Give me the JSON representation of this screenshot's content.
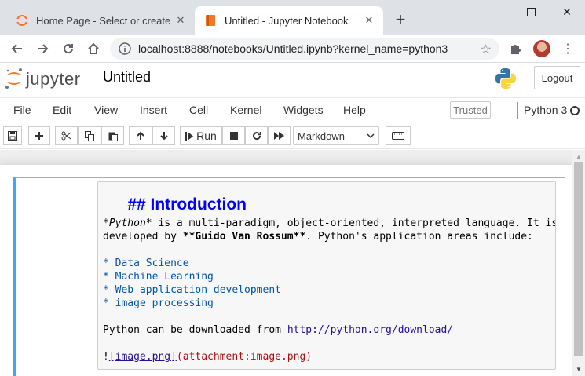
{
  "browser": {
    "tabs": [
      {
        "title": "Home Page - Select or create a n",
        "active": false
      },
      {
        "title": "Untitled - Jupyter Notebook",
        "active": true
      }
    ],
    "url": "localhost:8888/notebooks/Untitled.ipynb?kernel_name=python3"
  },
  "jupyter": {
    "logo_text": "jupyter",
    "notebook_name": "Untitled",
    "logout_label": "Logout",
    "menu": [
      "File",
      "Edit",
      "View",
      "Insert",
      "Cell",
      "Kernel",
      "Widgets",
      "Help"
    ],
    "trusted_label": "Trusted",
    "kernel_name": "Python 3",
    "toolbar": {
      "run_label": "Run",
      "cell_type": "Markdown"
    }
  },
  "cell": {
    "lines": {
      "heading": "## Introduction",
      "p1_em": "*Python*",
      "p1_rest": " is a multi-paradigm, object-oriented, interpreted language. It is",
      "p2_a": "developed by ",
      "p2_strong": "**Guido Van Rossum**",
      "p2_b": ". Python's application areas include:",
      "items": [
        "* Data Science",
        "* Machine Learning",
        "* Web application development",
        "* image processing"
      ],
      "download_prefix": "Python can be downloaded from ",
      "download_url": "http://python.org/download/",
      "img_bang": "!",
      "img_alt": "[image.png]",
      "img_target": "(attachment:image.png)"
    }
  },
  "colors": {
    "cell_selected_border": "#42a5f5",
    "heading": "#0000ff",
    "list": "#0055aa",
    "link": "#221199"
  }
}
